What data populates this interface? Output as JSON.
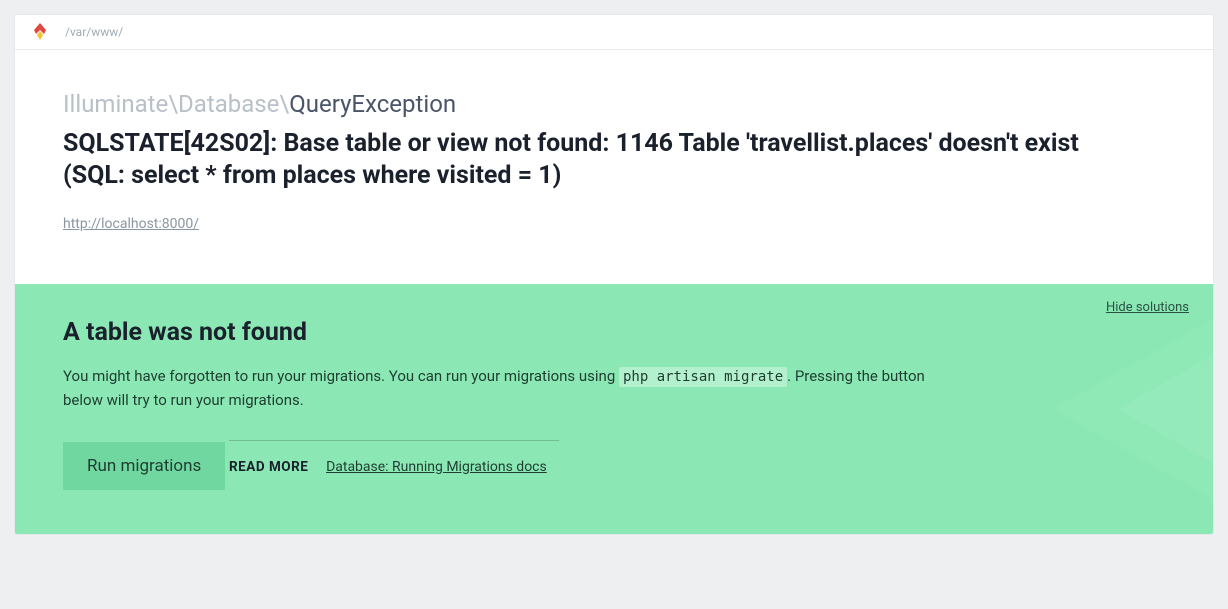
{
  "header": {
    "breadcrumb": "/var/www/"
  },
  "exception": {
    "namespace": "Illuminate\\Database\\",
    "class": "QueryException",
    "message": "SQLSTATE[42S02]: Base table or view not found: 1146 Table 'travellist.places' doesn't exist (SQL: select * from places where visited = 1)",
    "url": "http://localhost:8000/"
  },
  "solution": {
    "hide_label": "Hide solutions",
    "title": "A table was not found",
    "text_before_code": "You might have forgotten to run your migrations. You can run your migrations using ",
    "code": "php artisan migrate",
    "text_after_code": ". Pressing the button below will try to run your migrations.",
    "button_label": "Run migrations",
    "readmore_label": "READ MORE",
    "readmore_link_text": "Database: Running Migrations docs"
  }
}
